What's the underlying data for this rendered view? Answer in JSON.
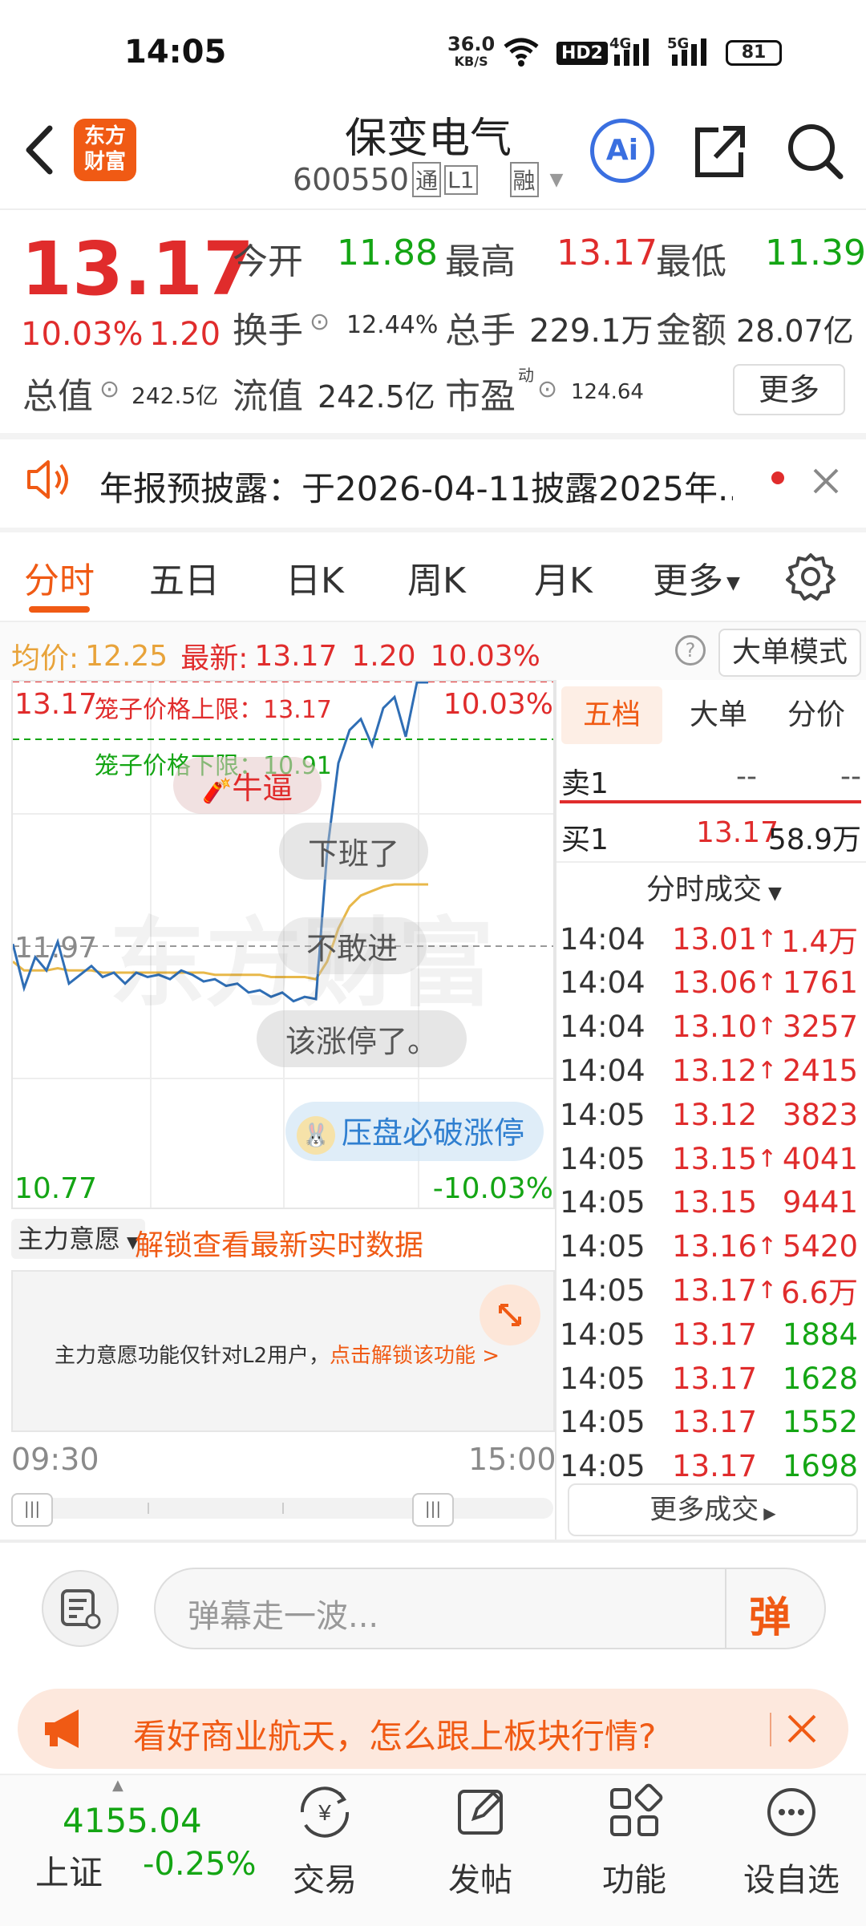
{
  "status_bar": {
    "time": "14:05",
    "net_speed": "36.0",
    "net_unit": "KB/S",
    "hd": "HD2",
    "sig1": "4G",
    "sig2": "5G",
    "battery": "81"
  },
  "header": {
    "back_icon": "chevron-left-icon",
    "logo_text_1": "东方",
    "logo_text_2": "财富",
    "title": "保变电气",
    "code": "600550",
    "tag1": "通",
    "tag2": "L1",
    "tag3": "融",
    "ai_label": "Ai"
  },
  "quote": {
    "price": "13.17",
    "change_pct": "10.03%",
    "change": "1.20",
    "open_label": "今开",
    "open": "11.88",
    "high_label": "最高",
    "high": "13.17",
    "low_label": "最低",
    "low": "11.39",
    "turnover_label": "换手",
    "turnover": "12.44%",
    "volume_label": "总手",
    "volume": "229.1万",
    "amount_label": "金额",
    "amount": "28.07亿",
    "mcap_label": "总值",
    "mcap": "242.5亿",
    "float_label": "流值",
    "float_cap": "242.5亿",
    "pe_label": "市盈",
    "pe_sup": "动",
    "pe": "124.64",
    "more_btn": "更多"
  },
  "notice": {
    "text": "年报预披露：于2026-04-11披露2025年..."
  },
  "tabs": [
    "分时",
    "五日",
    "日K",
    "周K",
    "月K",
    "更多"
  ],
  "info_line": {
    "avg_label": "均价:",
    "avg": "12.25",
    "latest_label": "最新:",
    "latest": "13.17",
    "chg": "1.20",
    "pct": "10.03%",
    "mode_btn": "大单模式"
  },
  "chart": {
    "top_price": "13.17",
    "top_pct": "10.03%",
    "limit_up_label": "笼子价格上限：13.17",
    "limit_down_label": "笼子价格下限：10.91",
    "mid_price": "11.97",
    "watermark": "东方财富",
    "bottom_price": "10.77",
    "bottom_pct": "-10.03%",
    "time_start": "09:30",
    "time_end": "15:00",
    "danmu": [
      "牛逼",
      "下班了",
      "不敢进",
      "该涨停了。",
      "压盘必破涨停"
    ]
  },
  "chart_data": {
    "type": "line",
    "series": [
      {
        "name": "价格",
        "values": [
          11.98,
          11.78,
          11.92,
          11.86,
          11.99,
          11.8,
          11.84,
          11.88,
          11.83,
          11.85,
          11.8,
          11.85,
          11.83,
          11.84,
          11.82,
          11.86,
          11.84,
          11.81,
          11.82,
          11.79,
          11.8,
          11.76,
          11.77,
          11.74,
          11.76,
          11.72,
          11.74,
          11.73,
          12.4,
          12.8,
          12.95,
          13.0,
          12.88,
          13.05,
          13.1,
          12.92,
          13.17,
          13.17
        ]
      },
      {
        "name": "均价",
        "values": [
          11.9,
          11.86,
          11.86,
          11.86,
          11.87,
          11.86,
          11.86,
          11.86,
          11.85,
          11.85,
          11.85,
          11.85,
          11.85,
          11.85,
          11.85,
          11.85,
          11.85,
          11.85,
          11.84,
          11.84,
          11.84,
          11.84,
          11.84,
          11.83,
          11.83,
          11.83,
          11.83,
          11.82,
          11.9,
          12.05,
          12.15,
          12.2,
          12.22,
          12.24,
          12.25,
          12.25,
          12.25,
          12.25
        ]
      }
    ],
    "ylim": [
      10.77,
      13.17
    ]
  },
  "main_force": {
    "dropdown": "主力意愿",
    "unlock_text": "解锁查看最新实时数据",
    "desc": "主力意愿功能仅针对L2用户，",
    "link": "点击解锁该功能 >"
  },
  "side_tabs": [
    "五档",
    "大单",
    "分价"
  ],
  "book": {
    "sell_label": "卖1",
    "sell_price": "--",
    "sell_vol": "--",
    "buy_label": "买1",
    "buy_price": "13.17",
    "buy_vol": "58.9万"
  },
  "trades_header": "分时成交",
  "trades": [
    {
      "time": "14:04",
      "price": "13.01",
      "arrow": "↑",
      "vol": "1.4万",
      "vc": "red"
    },
    {
      "time": "14:04",
      "price": "13.06",
      "arrow": "↑",
      "vol": "1761",
      "vc": "red"
    },
    {
      "time": "14:04",
      "price": "13.10",
      "arrow": "↑",
      "vol": "3257",
      "vc": "red"
    },
    {
      "time": "14:04",
      "price": "13.12",
      "arrow": "↑",
      "vol": "2415",
      "vc": "red"
    },
    {
      "time": "14:05",
      "price": "13.12",
      "arrow": "",
      "vol": "3823",
      "vc": "red"
    },
    {
      "time": "14:05",
      "price": "13.15",
      "arrow": "↑",
      "vol": "4041",
      "vc": "red"
    },
    {
      "time": "14:05",
      "price": "13.15",
      "arrow": "",
      "vol": "9441",
      "vc": "red"
    },
    {
      "time": "14:05",
      "price": "13.16",
      "arrow": "↑",
      "vol": "5420",
      "vc": "red"
    },
    {
      "time": "14:05",
      "price": "13.17",
      "arrow": "↑",
      "vol": "6.6万",
      "vc": "red"
    },
    {
      "time": "14:05",
      "price": "13.17",
      "arrow": "",
      "vol": "1884",
      "vc": "green"
    },
    {
      "time": "14:05",
      "price": "13.17",
      "arrow": "",
      "vol": "1628",
      "vc": "green"
    },
    {
      "time": "14:05",
      "price": "13.17",
      "arrow": "",
      "vol": "1552",
      "vc": "green"
    },
    {
      "time": "14:05",
      "price": "13.17",
      "arrow": "",
      "vol": "1698",
      "vc": "green"
    }
  ],
  "more_trades": "更多成交",
  "comment": {
    "placeholder": "弹幕走一波...",
    "send": "弹"
  },
  "promo": {
    "text": "看好商业航天，怎么跟上板块行情?"
  },
  "bottom_nav": {
    "index_value": "4155.04",
    "index_name": "上证",
    "index_pct": "-0.25%",
    "trade": "交易",
    "post": "发帖",
    "func": "功能",
    "watch": "设自选"
  },
  "colors": {
    "up": "#e02c2c",
    "down": "#14a514",
    "accent": "#f05a14",
    "price_line": "#2f6eb5",
    "avg_line": "#e8b84a"
  }
}
